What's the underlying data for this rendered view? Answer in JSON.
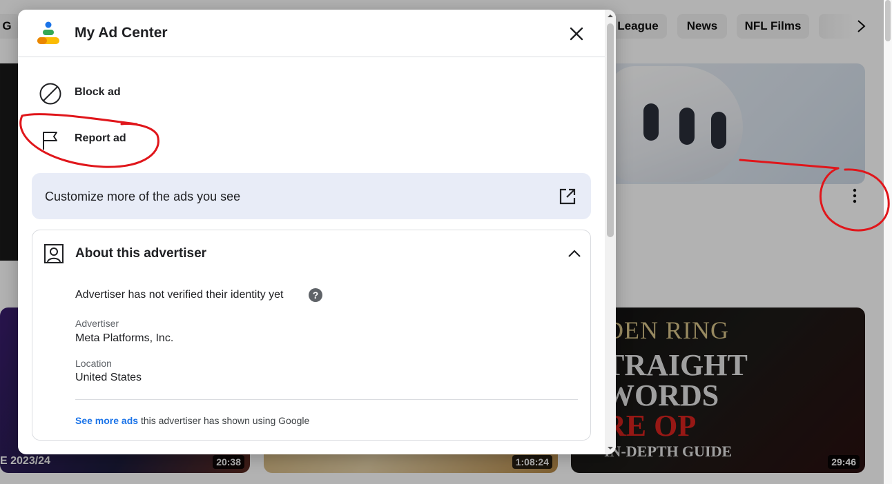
{
  "chips": {
    "partial_left": "G",
    "items": [
      "League",
      "News",
      "NFL Films"
    ]
  },
  "videos": [
    {
      "duration": "20:38",
      "thumb_text": "E 2023/24"
    },
    {
      "duration": "1:08:24"
    },
    {
      "duration": "29:46",
      "title_lines": [
        "DEN RING",
        "TRAIGHT",
        "WORDS",
        "RE OP",
        "IN-DEPTH GUIDE"
      ]
    }
  ],
  "dialog": {
    "title": "My Ad Center",
    "actions": [
      {
        "label": "Block ad",
        "icon": "block-icon"
      },
      {
        "label": "Report ad",
        "icon": "flag-icon"
      }
    ],
    "customize_label": "Customize more of the ads you see",
    "about": {
      "title": "About this advertiser",
      "verification": "Advertiser has not verified their identity yet",
      "advertiser_label": "Advertiser",
      "advertiser_value": "Meta Platforms, Inc.",
      "location_label": "Location",
      "location_value": "United States",
      "see_more_link": "See more ads",
      "see_more_rest": " this advertiser has shown using Google"
    }
  },
  "colors": {
    "link": "#1a73e8",
    "customize_bg": "#e8ecf7",
    "annotation": "#e0161b"
  }
}
